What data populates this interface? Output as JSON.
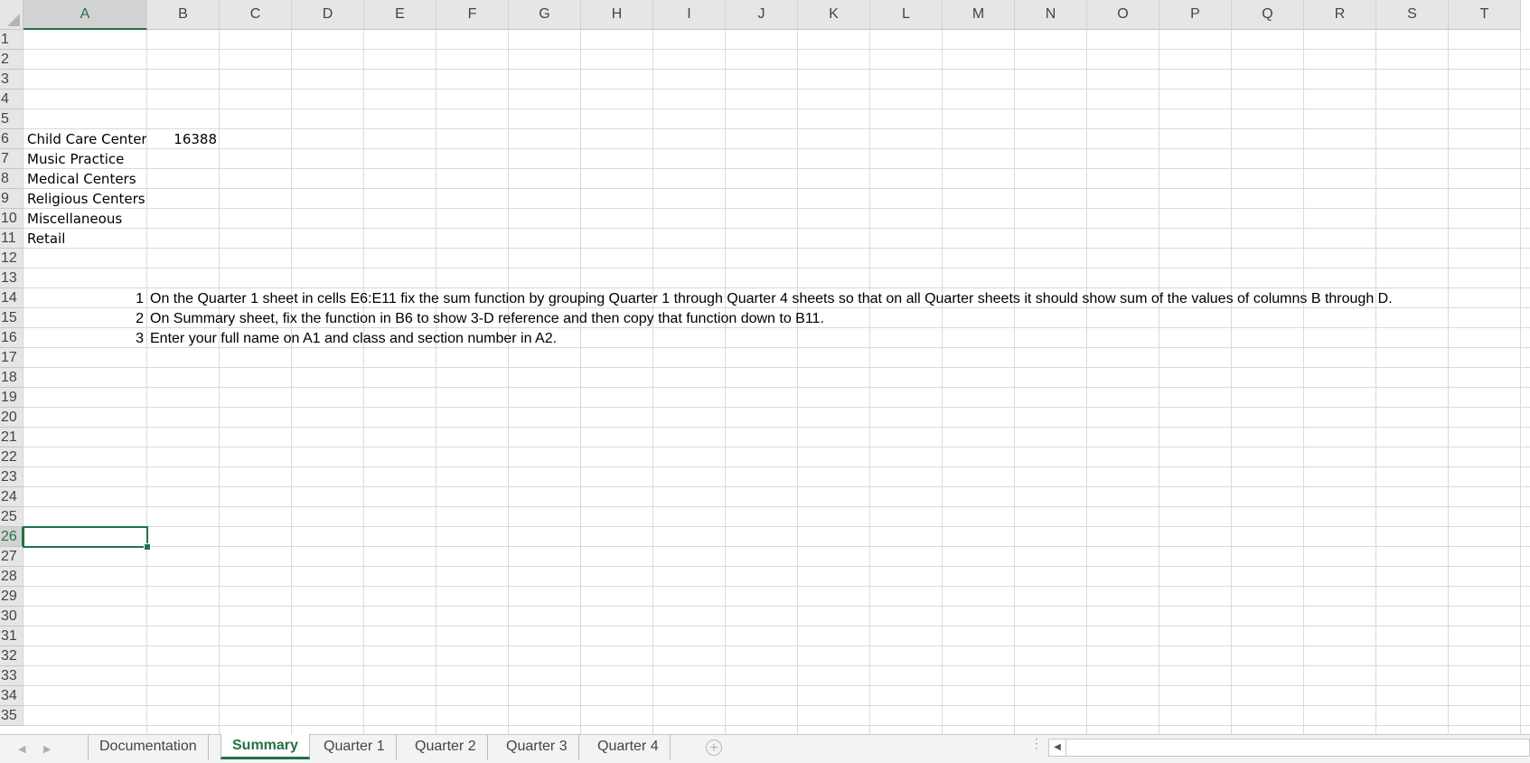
{
  "sheet": {
    "columns": [
      "A",
      "B",
      "C",
      "D",
      "E",
      "F",
      "G",
      "H",
      "I",
      "J",
      "K",
      "L",
      "M",
      "N",
      "O",
      "P",
      "Q",
      "R",
      "S",
      "T"
    ],
    "rows": [
      "1",
      "2",
      "3",
      "4",
      "5",
      "6",
      "7",
      "8",
      "9",
      "10",
      "11",
      "12",
      "13",
      "14",
      "15",
      "16",
      "17",
      "18",
      "19",
      "20",
      "21",
      "22",
      "23",
      "24",
      "25",
      "26",
      "27",
      "28",
      "29",
      "30",
      "31",
      "32",
      "33",
      "34",
      "35"
    ],
    "active_column": "A",
    "active_row": "26",
    "selected_cell": "A26",
    "cells": {
      "A6": "Child Care Centers",
      "B6": "16388",
      "A7": "Music Practice",
      "A8": "Medical Centers",
      "A9": "Religious Centers",
      "A10": "Miscellaneous",
      "A11": "Retail",
      "A14": "1",
      "B14": "On the Quarter 1 sheet in cells E6:E11 fix the sum function by grouping Quarter 1 through Quarter 4 sheets so that on all Quarter sheets it should show sum of the values of columns B through D.",
      "A15": "2",
      "B15": "On Summary sheet, fix the function in B6 to show 3-D reference and then copy that function down to B11.",
      "A16": "3",
      "B16": "Enter your full name on A1 and class and section number in A2."
    }
  },
  "tabs": {
    "items": [
      {
        "label": "Documentation"
      },
      {
        "label": "Summary"
      },
      {
        "label": "Quarter 1"
      },
      {
        "label": "Quarter 2"
      },
      {
        "label": "Quarter 3"
      },
      {
        "label": "Quarter 4"
      }
    ],
    "active": "Summary",
    "add_icon": "plus-circle-icon",
    "prev_icon": "triangle-left-icon",
    "next_icon": "triangle-right-icon"
  },
  "colors": {
    "accent": "#217346",
    "header_bg": "#e6e6e6",
    "gridline": "#dadada"
  }
}
